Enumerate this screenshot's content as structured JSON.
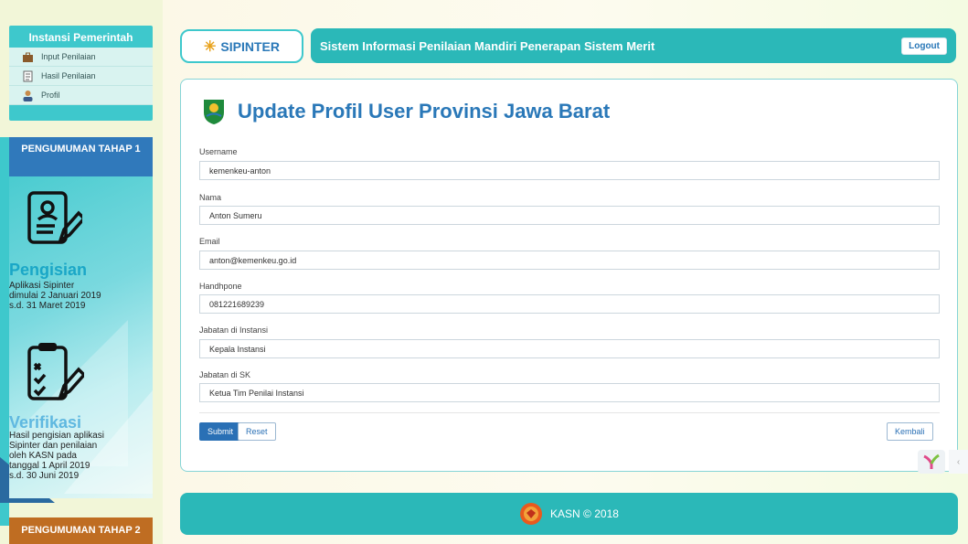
{
  "sidebar": {
    "menu_title": "Instansi Pemerintah",
    "items": [
      {
        "label": "Input Penilaian",
        "icon": "briefcase-icon"
      },
      {
        "label": "Hasil Penilaian",
        "icon": "document-icon"
      },
      {
        "label": "Profil",
        "icon": "user-icon"
      }
    ],
    "announcement1": {
      "title": "PENGUMUMAN TAHAP 1",
      "step1_title": "Pengisian",
      "step1_text": [
        "Aplikasi Sipinter",
        "dimulai 2 Januari 2019",
        "s.d. 31 Maret 2019"
      ],
      "step2_title": "Verifikasi",
      "step2_text": [
        "Hasil pengisian aplikasi",
        "Sipinter dan penilaian",
        "oleh KASN pada",
        "tanggal 1 April 2019",
        "s.d. 30 Juni 2019"
      ]
    },
    "announcement2": {
      "title": "PENGUMUMAN TAHAP 2"
    }
  },
  "header": {
    "logo_text": "SIPINTER",
    "title": "Sistem Informasi Penilaian Mandiri Penerapan Sistem Merit",
    "logout_label": "Logout"
  },
  "form": {
    "page_title": "Update Profil User Provinsi Jawa Barat",
    "fields": [
      {
        "label": "Username",
        "value": "kemenkeu-anton"
      },
      {
        "label": "Nama",
        "value": "Anton Sumeru"
      },
      {
        "label": "Email",
        "value": "anton@kemenkeu.go.id"
      },
      {
        "label": "Handhpone",
        "value": "081221689239"
      },
      {
        "label": "Jabatan di Instansi",
        "value": "Kepala Instansi"
      },
      {
        "label": "Jabatan di SK",
        "value": "Ketua Tim Penilai Instansi"
      }
    ],
    "submit_label": "Submit",
    "reset_label": "Reset",
    "back_label": "Kembali"
  },
  "footer": {
    "text": "KASN © 2018"
  },
  "colors": {
    "teal": "#2bb8b8",
    "blue": "#2a78b8",
    "accent_orange": "#bf6d22"
  }
}
